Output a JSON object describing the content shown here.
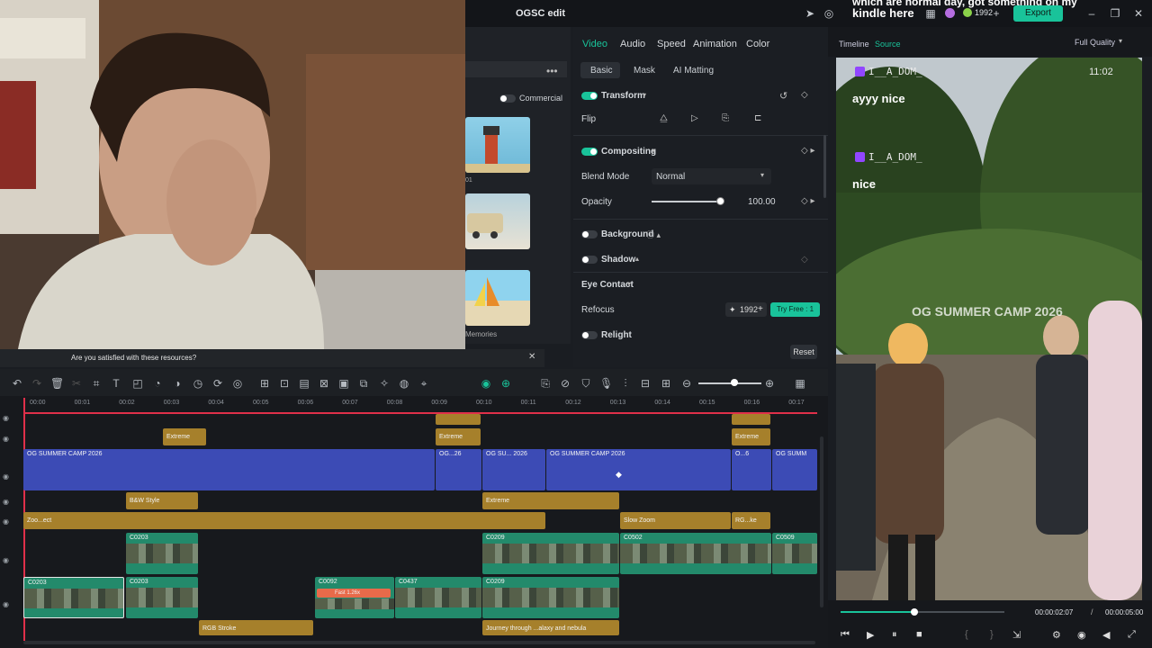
{
  "titlebar": {
    "title": "OGSC edit",
    "credits": "1992",
    "export_label": "Export",
    "overlay_text": "kindle here",
    "overlay_top": "which are normal day, got something on my"
  },
  "media": {
    "commercial_label": "Commercial",
    "item_caption_1": "01",
    "item_caption_3": "Memories"
  },
  "webcam": {
    "satisfied_text": "Are you satisfied with these resources?"
  },
  "props": {
    "tabs": [
      "Video",
      "Audio",
      "Speed",
      "Animation",
      "Color"
    ],
    "subtabs": [
      "Basic",
      "Mask",
      "AI Matting"
    ],
    "transform_label": "Transform",
    "flip_label": "Flip",
    "compositing_label": "Compositing",
    "blend_mode_label": "Blend Mode",
    "blend_mode_value": "Normal",
    "opacity_label": "Opacity",
    "opacity_value": "100.00",
    "background_label": "Background",
    "shadow_label": "Shadow",
    "eye_contact_label": "Eye Contact",
    "refocus_label": "Refocus",
    "refocus_credits": "1992",
    "try_free_label": "Try Free : 1",
    "relight_label": "Relight",
    "reset_label": "Reset"
  },
  "viewer": {
    "tab_timeline": "Timeline",
    "tab_source": "Source",
    "quality": "Full Quality",
    "chat_user_1": "I__A_DOM_",
    "chat_msg_1": "ayyy nice",
    "chat_user_2": "I__A_DOM_",
    "chat_msg_2": "nice",
    "chat_time": "11:02",
    "overlay_title": "OG SUMMER CAMP 2026",
    "time_current": "00:00:02:07",
    "time_total": "00:00:05:00",
    "playhead_fraction": 0.45
  },
  "timeline": {
    "ruler": [
      "00:00",
      "00:01",
      "00:02",
      "00:03",
      "00:04",
      "00:05",
      "00:06",
      "00:07",
      "00:08",
      "00:09",
      "00:10",
      "00:11",
      "00:12",
      "00:13",
      "00:14",
      "00:15",
      "00:16",
      "00:17"
    ],
    "clips": {
      "extreme": "Extreme",
      "og": "OG SUMMER CAMP 2026",
      "og_short_1": "OG...26",
      "og_short_2": "OG SU... 2026",
      "og_short_3": "O...6",
      "og_short_4": "OG SUMM",
      "bw": "B&W Style",
      "zoom": "Zoo...ect",
      "slow_zoom": "Slow Zoom",
      "rg": "RG...ke",
      "c0203": "C0203",
      "c0209": "C0209",
      "c0502": "C0502",
      "c0509": "C0509",
      "c0092": "C0092",
      "c0437": "C0437",
      "fast": "Fast 1.26x",
      "rgb_stroke": "RGB Stroke",
      "journey": "Journey through ...alaxy and nebula"
    }
  },
  "colors": {
    "accent": "#19c39a",
    "effect_clip": "#a6802b",
    "title_clip": "#3c4bb5",
    "video_clip": "#238a6b"
  }
}
